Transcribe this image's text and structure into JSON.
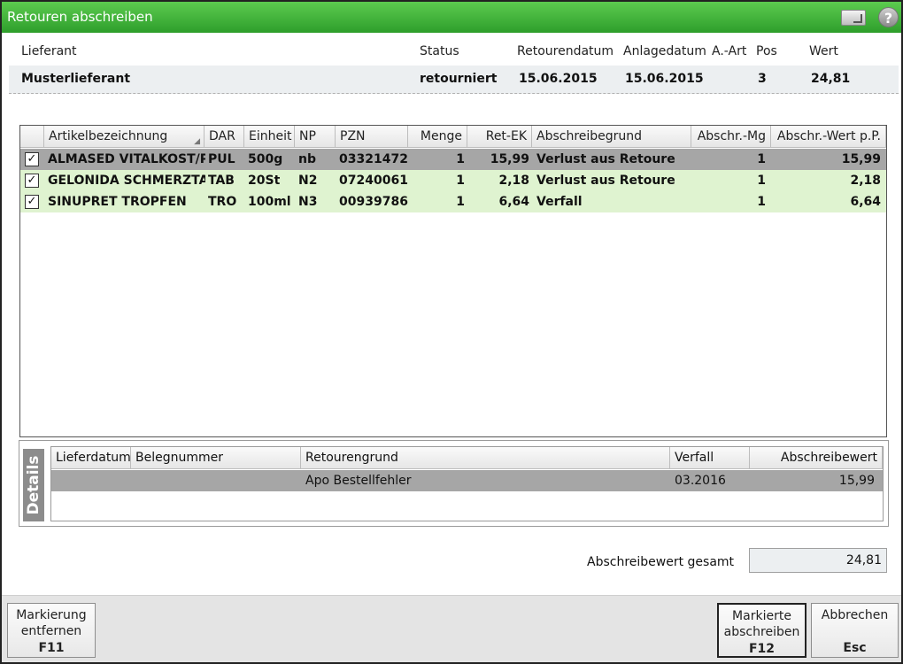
{
  "window": {
    "title": "Retouren abschreiben"
  },
  "header": {
    "labels": {
      "lieferant": "Lieferant",
      "status": "Status",
      "retourendatum": "Retourendatum",
      "anlagedatum": "Anlagedatum",
      "art": "A.-Art",
      "pos": "Pos",
      "wert": "Wert"
    },
    "values": {
      "lieferant": "Musterlieferant",
      "status": "retourniert",
      "retourendatum": "15.06.2015",
      "anlagedatum": "15.06.2015",
      "art": "",
      "pos": "3",
      "wert": "24,81"
    }
  },
  "grid": {
    "columns": [
      "Artikelbezeichnung",
      "DAR",
      "Einheit",
      "NP",
      "PZN",
      "Menge",
      "Ret-EK",
      "Abschreibegrund",
      "Abschr.-Mg",
      "Abschr.-Wert p.P."
    ],
    "rows": [
      {
        "checked": true,
        "name": "ALMASED VITALKOST/PULVER",
        "dar": "PUL",
        "einheit": "500g",
        "np": "nb",
        "pzn": "03321472",
        "menge": "1",
        "retek": "15,99",
        "grund": "Verlust aus Retoure",
        "mg": "1",
        "wert": "15,99"
      },
      {
        "checked": true,
        "name": "GELONIDA SCHMERZTABLETTEN",
        "dar": "TAB",
        "einheit": "20St",
        "np": "N2",
        "pzn": "07240061",
        "menge": "1",
        "retek": "2,18",
        "grund": "Verlust aus Retoure",
        "mg": "1",
        "wert": "2,18"
      },
      {
        "checked": true,
        "name": "SINUPRET TROPFEN",
        "dar": "TRO",
        "einheit": "100ml",
        "np": "N3",
        "pzn": "00939786",
        "menge": "1",
        "retek": "6,64",
        "grund": "Verfall",
        "mg": "1",
        "wert": "6,64"
      }
    ]
  },
  "details": {
    "tab_label": "Details",
    "columns": [
      "Lieferdatum",
      "Belegnummer",
      "Retourengrund",
      "Verfall",
      "Abschreibewert"
    ],
    "row": {
      "lieferdatum": "",
      "belegnummer": "",
      "retourengrund": "Apo Bestellfehler",
      "verfall": "03.2016",
      "abschreibewert": "15,99"
    }
  },
  "total": {
    "label": "Abschreibewert gesamt",
    "value": "24,81"
  },
  "buttons": {
    "remove": {
      "line1": "Markierung",
      "line2": "entfernen",
      "key": "F11"
    },
    "writeoff": {
      "line1": "Markierte",
      "line2": "abschreiben",
      "key": "F12"
    },
    "cancel": {
      "line1": "Abbrechen",
      "line2": "",
      "key": "Esc"
    }
  },
  "colors": {
    "titlebar": "#3fb23a",
    "selected_row": "#a6a6a6",
    "alt_row": "#dff3d0"
  },
  "icons": {
    "window": "window-restore-icon",
    "help": "help-icon",
    "check": "checkmark-icon"
  }
}
